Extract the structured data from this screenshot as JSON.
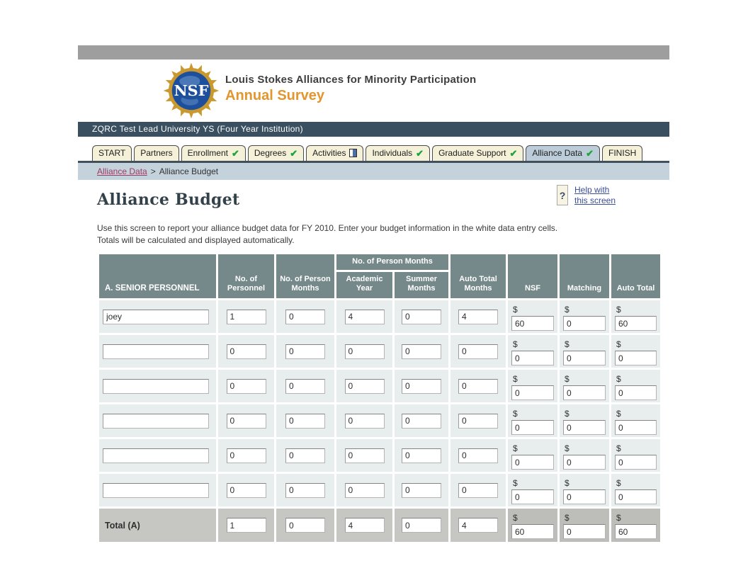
{
  "page": {
    "title": "Alliance Budget"
  },
  "brand": {
    "logo_text": "NSF",
    "line1": "Louis Stokes Alliances for Minority Participation",
    "line2": "Annual Survey",
    "line2_color": "#E3962F"
  },
  "institution": {
    "text": "ZQRC Test Lead University YS (Four Year Institution)",
    "bg": "#3A4F60"
  },
  "icons": {
    "check": "✔",
    "help": "?"
  },
  "tabs": [
    {
      "label": "START",
      "status": "none"
    },
    {
      "label": "Partners",
      "status": "none"
    },
    {
      "label": "Enrollment",
      "status": "check"
    },
    {
      "label": "Degrees",
      "status": "check"
    },
    {
      "label": "Activities",
      "status": "partial"
    },
    {
      "label": "Individuals",
      "status": "check"
    },
    {
      "label": "Graduate Support",
      "status": "check"
    },
    {
      "label": "Alliance Data",
      "status": "check",
      "active": true
    },
    {
      "label": "FINISH",
      "status": "none"
    }
  ],
  "breadcrumb": {
    "link": "Alliance Data",
    "separator": ">",
    "current": "Alliance Budget"
  },
  "help": {
    "icon": "?",
    "line1": "Help with",
    "line2": "this screen"
  },
  "instructions": [
    "Use this screen to report your alliance budget data for FY 2010. Enter your budget information in the white data entry cells.",
    "Totals will be calculated and displayed automatically."
  ],
  "table": {
    "currency": "$",
    "headers": {
      "section": "A. SENIOR PERSONNEL",
      "personnel": "No. of Personnel",
      "person_months": "No. of Person Months",
      "group_person_months": "No. of Person Months",
      "academic_year": "Academic Year",
      "summer_months": "Summer Months",
      "auto_total_months": "Auto Total Months",
      "nsf": "NSF",
      "matching": "Matching",
      "auto_total": "Auto Total"
    },
    "rows": [
      {
        "name": "joey",
        "personnel": "1",
        "person_months": "0",
        "academic_year": "4",
        "summer_months": "0",
        "auto_total_months": "4",
        "nsf": "60",
        "matching": "0",
        "auto_total": "60"
      },
      {
        "name": "",
        "personnel": "0",
        "person_months": "0",
        "academic_year": "0",
        "summer_months": "0",
        "auto_total_months": "0",
        "nsf": "0",
        "matching": "0",
        "auto_total": "0"
      },
      {
        "name": "",
        "personnel": "0",
        "person_months": "0",
        "academic_year": "0",
        "summer_months": "0",
        "auto_total_months": "0",
        "nsf": "0",
        "matching": "0",
        "auto_total": "0"
      },
      {
        "name": "",
        "personnel": "0",
        "person_months": "0",
        "academic_year": "0",
        "summer_months": "0",
        "auto_total_months": "0",
        "nsf": "0",
        "matching": "0",
        "auto_total": "0"
      },
      {
        "name": "",
        "personnel": "0",
        "person_months": "0",
        "academic_year": "0",
        "summer_months": "0",
        "auto_total_months": "0",
        "nsf": "0",
        "matching": "0",
        "auto_total": "0"
      },
      {
        "name": "",
        "personnel": "0",
        "person_months": "0",
        "academic_year": "0",
        "summer_months": "0",
        "auto_total_months": "0",
        "nsf": "0",
        "matching": "0",
        "auto_total": "0"
      }
    ],
    "total": {
      "label": "Total (A)",
      "personnel": "1",
      "person_months": "0",
      "academic_year": "4",
      "summer_months": "0",
      "auto_total_months": "4",
      "nsf": "60",
      "matching": "0",
      "auto_total": "60"
    }
  },
  "colors": {
    "topbar": "#9E9E9E",
    "header_cell": "#75888A",
    "data_cell": "#E8EEEE",
    "total_cell": "#C6C7C3",
    "active_tab": "#BCCDD9",
    "tab_bg": "#F5F0D8",
    "breadcrumb_bg": "#C3D2DB",
    "check_green": "#1FA33C",
    "link_blue": "#3A4E96",
    "crumb_link": "#9E3A62"
  }
}
